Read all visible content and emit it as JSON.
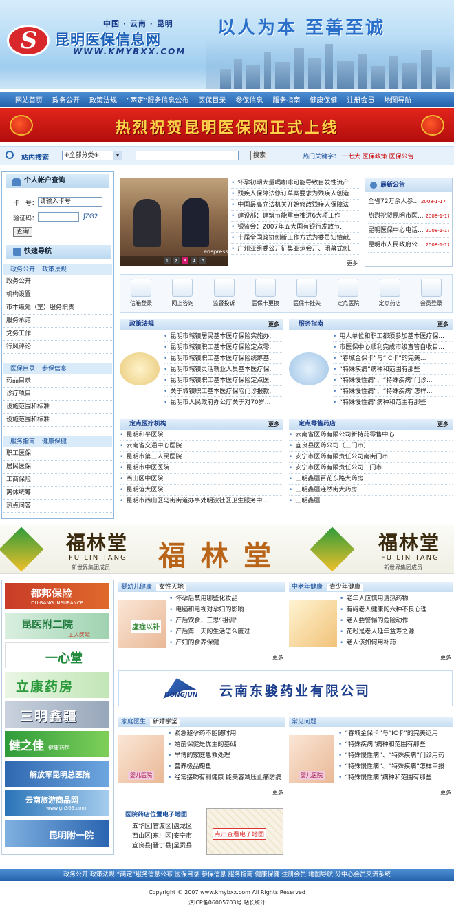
{
  "header": {
    "subtitle": "中国 · 云南 · 昆明",
    "title": "昆明医保信息网",
    "url": "WWW.KMYBXX.COM",
    "slogan": "以人为本  至善至诚",
    "logo_letter": "S"
  },
  "nav": [
    "网站首页",
    "政务公开",
    "政策法规",
    "“两定”服务信息公布",
    "医保目录",
    "参保信息",
    "服务指南",
    "健康保健",
    "注册会员",
    "地图导航"
  ],
  "banner": "热烈祝贺昆明医保网正式上线",
  "search": {
    "label": "站内搜索",
    "select": "※全部分类※",
    "button": "搜索",
    "hot_label": "热门关键字：",
    "hot": [
      "十七大",
      "医保政策",
      "医保公告"
    ]
  },
  "account": {
    "title": "个人帐户查询",
    "card_label": "卡　号：",
    "card_placeholder": "请输入卡号",
    "code_label": "验证码：",
    "code": "JZG2",
    "query": "查询"
  },
  "quick": {
    "title": "快速导航",
    "groups": [
      {
        "tabs": [
          "政务公开",
          "政策法规"
        ],
        "items": [
          "政务公开",
          "机构设置",
          "市本级处（室）服务职责",
          "服务承诺",
          "党务工作",
          "行风评论"
        ]
      },
      {
        "tabs": [
          "医保目录",
          "参保信息"
        ],
        "items": [
          "药品目录",
          "诊疗项目",
          "设施范围和标准",
          "设施范围和标准"
        ]
      },
      {
        "tabs": [
          "服务指南",
          "健康保健"
        ],
        "items": [
          "职工医保",
          "居民医保",
          "工商保险",
          "离休统筹",
          "热点问答"
        ]
      }
    ]
  },
  "news": {
    "slides": [
      "1",
      "2",
      "3",
      "4",
      "5"
    ],
    "slide_caption": "enspress",
    "items": [
      "怀孕初期大量喝咖啡可能导致自发性流产",
      "残疾人保障法修订草案要求为残疾人创造...",
      "中国最高立法机关开始修改残疾人保障法",
      "建设部：建筑节能重点推进6大项工作",
      "银监会：2007年五大国有银行发放节...",
      "十届全国政协创新工作方式为委员知情献...",
      "广州亚组委公开征集亚运会开、闭幕式创..."
    ],
    "more": "更多"
  },
  "notice": {
    "title": "最新公告",
    "items": [
      {
        "t": "全省72万余人参...",
        "d": "2008-1-17"
      },
      {
        "t": "热烈祝贺昆明市医...",
        "d": "2008-1-17"
      },
      {
        "t": "昆明医保中心电话...",
        "d": "2008-1-17"
      },
      {
        "t": "昆明市人民政府公...",
        "d": "2008-1-17"
      }
    ]
  },
  "icons": [
    {
      "label": "信箱登录",
      "icon": "mail-icon"
    },
    {
      "label": "网上咨询",
      "icon": "monitor-icon"
    },
    {
      "label": "监督投诉",
      "icon": "phone-icon"
    },
    {
      "label": "医保卡更换",
      "icon": "card-icon"
    },
    {
      "label": "医保卡挂失",
      "icon": "card-lock-icon"
    },
    {
      "label": "定点医院",
      "icon": "hospital-icon"
    },
    {
      "label": "定点药店",
      "icon": "pharmacy-icon"
    },
    {
      "label": "会员登录",
      "icon": "login-icon"
    }
  ],
  "policy": {
    "title": "政策法规",
    "more": "更多",
    "items": [
      "昆明市城镇居民基本医疗保险实施办...",
      "昆明市城镇职工基本医疗保险定点零...",
      "昆明市城镇职工基本医疗保险统筹基...",
      "昆明市城镇灵活就业人员基本医疗保...",
      "昆明市城镇职工基本医疗保险定点医...",
      "关于城镇职工基本医疗保险门诊报款...",
      "昆明市人民政府办公厅关于对70岁..."
    ]
  },
  "guide": {
    "title": "服务指南",
    "more": "更多",
    "items": [
      "用人单位和职工都须参加基本医疗保...",
      "市医保中心顺利完成市级直管自收目...",
      "“春城金保卡”与“IC卡”的完美...",
      "“特殊疾病”病种和范围有那些",
      "“特殊慢性病”、“特殊疾病”门诊...",
      "“特殊慢性病”、“特殊疾病”怎样...",
      "“特殊慢性病”病种和范围有那些"
    ]
  },
  "hospitals": {
    "title": "定点医疗机构",
    "more": "更多",
    "items": [
      "昆明和平医院",
      "云南省交通中心医院",
      "昆明市第三人民医院",
      "昆明市中医医院",
      "西山区中医院",
      "昆明谊大医院",
      "昆明市西山区马街街道办事处明波社区卫生服务中..."
    ]
  },
  "pharmacies": {
    "title": "定点零售药店",
    "more": "更多",
    "items": [
      "云南省医药有限公司新特药零售中心",
      "宜良县医药公司（三门市）",
      "安宁市医药有限责任公司南街门市",
      "安宁市医药有限责任公司一门市",
      "三明鑫疆百花东路大药房",
      "三明鑫疆连然街大药房",
      "三明鑫疆..."
    ]
  },
  "ad1": {
    "brand_cn": "福林堂",
    "brand_en": "FU LIN TANG",
    "sub": "新世界集团成员",
    "center": "福 林 堂"
  },
  "side_ads": [
    {
      "name": "都邦保险",
      "sub": "DU-BANG INSURANCE"
    },
    {
      "name": "昆医附二院",
      "sub": "工人医院"
    },
    {
      "name": "一心堂",
      "sub": ""
    },
    {
      "name": "立康药房",
      "sub": ""
    },
    {
      "name": "三明鑫疆",
      "sub": ""
    },
    {
      "name": "健之佳",
      "sub": "健康药房"
    },
    {
      "name": "解放军昆明总医院",
      "sub": ""
    },
    {
      "name": "云南旅游商品网",
      "sub": "www.gn369.com"
    },
    {
      "name": "昆明附一院",
      "sub": ""
    }
  ],
  "women": {
    "tabs": [
      "婴幼儿健康",
      "女性天地"
    ],
    "more": "更多",
    "img": "虚症以补",
    "items": [
      "怀孕后禁用哪些化妆品",
      "电脑和电视对孕妇的影响",
      "产后饮食，三思“祖训”",
      "产后第一天的生活怎么度过",
      "产妇的食养保健"
    ]
  },
  "elder": {
    "tabs": [
      "中老年健康",
      "青少年健康"
    ],
    "more": "更多",
    "items": [
      "老年人应慎用清热药物",
      "有碍老人健康的六种不良心理",
      "老人要警惕的危险动作",
      "花粉是老人延年益寿之源",
      "老人该如何用补药"
    ]
  },
  "ad2": {
    "brand": "DONGJUN",
    "text": "云南东骏药业有限公司"
  },
  "family": {
    "tabs": [
      "家庭医生",
      "新婚学堂"
    ],
    "more": "更多",
    "img": "婴儿医院",
    "items": [
      "紧急避孕药不能随时用",
      "婚前保健是优生的基础",
      "早博的家庭急救处理",
      "营养极品鲍鱼",
      "经常接吻有利健康 能美容减压止痛防病"
    ]
  },
  "faq": {
    "tabs": [
      "常见问题"
    ],
    "more": "更多",
    "img": "婴儿医院",
    "items": [
      "“春城金保卡”与“IC卡”的完美运用",
      "“特殊疾病”病种和范围有那些",
      "“特殊慢性病”、“特殊疾病”门诊用药",
      "“特殊慢性病”、“特殊疾病”怎样申报",
      "“特殊慢性病”病种和范围有那些"
    ]
  },
  "map": {
    "title": "医院药店位置电子地图",
    "districts": [
      "五华区|官渡区|盘龙区",
      "西山区|东川区|安宁市",
      "宜良县|晋宁县|呈贡县"
    ],
    "cta": "点击查看电子地图"
  },
  "footer": {
    "nav": "政务公开  政策法规  “两定”服务信息公布  医保目录  参保信息  服务指南  健康保健  注册会员  地图导航  分中心会员交流系统",
    "copyright": "Copyright © 2007 www.kmybxx.com All Rights Reserved",
    "icp": "滇ICP备06005703号 站长统计"
  }
}
